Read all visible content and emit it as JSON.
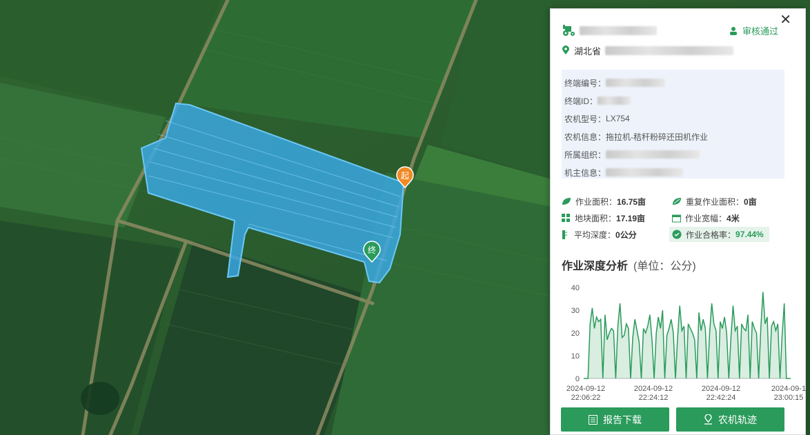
{
  "map": {
    "start_marker": "起",
    "end_marker": "终"
  },
  "panel": {
    "audit_label": "审核通过",
    "location_prefix": "湖北省",
    "info": [
      {
        "label": "终端编号：",
        "value": ""
      },
      {
        "label": "终端ID：",
        "value": ""
      },
      {
        "label": "农机型号：",
        "value": "LX754"
      },
      {
        "label": "农机信息：",
        "value": "拖拉机-秸秆粉碎还田机作业"
      },
      {
        "label": "所属组织：",
        "value": ""
      },
      {
        "label": "机主信息：",
        "value": ""
      }
    ],
    "stats": {
      "work_area_label": "作业面积：",
      "work_area": "16.75亩",
      "repeat_area_label": "重复作业面积：",
      "repeat_area": "0亩",
      "plot_area_label": "地块面积：",
      "plot_area": "17.19亩",
      "width_label": "作业宽幅：",
      "width": "4米",
      "depth_label": "平均深度：",
      "depth": "0公分",
      "pass_rate_label": "作业合格率：",
      "pass_rate": "97.44%"
    },
    "chart_title": "作业深度分析",
    "chart_unit": "(单位：公分)",
    "download_label": "报告下载",
    "track_label": "农机轨迹",
    "accent": "#2a9b5b"
  },
  "chart_data": {
    "type": "area",
    "ylim": [
      0,
      40
    ],
    "yticks": [
      0,
      10,
      20,
      30,
      40
    ],
    "xticks": [
      {
        "date": "2024-09-12",
        "time": "22:06:22"
      },
      {
        "date": "2024-09-12",
        "time": "22:24:12"
      },
      {
        "date": "2024-09-12",
        "time": "22:42:24"
      },
      {
        "date": "2024-09-1",
        "time": "23:00:15"
      }
    ],
    "series": [
      {
        "values": [
          0,
          0,
          0,
          24,
          31,
          22,
          27,
          25,
          26,
          0,
          28,
          17,
          20,
          22,
          21,
          0,
          23,
          33,
          18,
          19,
          24,
          22,
          0,
          18,
          26,
          21,
          16,
          0,
          22,
          20,
          23,
          28,
          17,
          0,
          20,
          27,
          22,
          30,
          0,
          19,
          22,
          26,
          20,
          0,
          18,
          32,
          21,
          23,
          0,
          24,
          22,
          20,
          17,
          0,
          29,
          21,
          26,
          22,
          0,
          20,
          33,
          24,
          21,
          0,
          25,
          22,
          27,
          20,
          0,
          18,
          32,
          21,
          23,
          0,
          24,
          22,
          21,
          28,
          0,
          25,
          22,
          20,
          0,
          22,
          38,
          24,
          27,
          0,
          23,
          25,
          21,
          24,
          0,
          19,
          33,
          0,
          0,
          0
        ]
      }
    ]
  }
}
